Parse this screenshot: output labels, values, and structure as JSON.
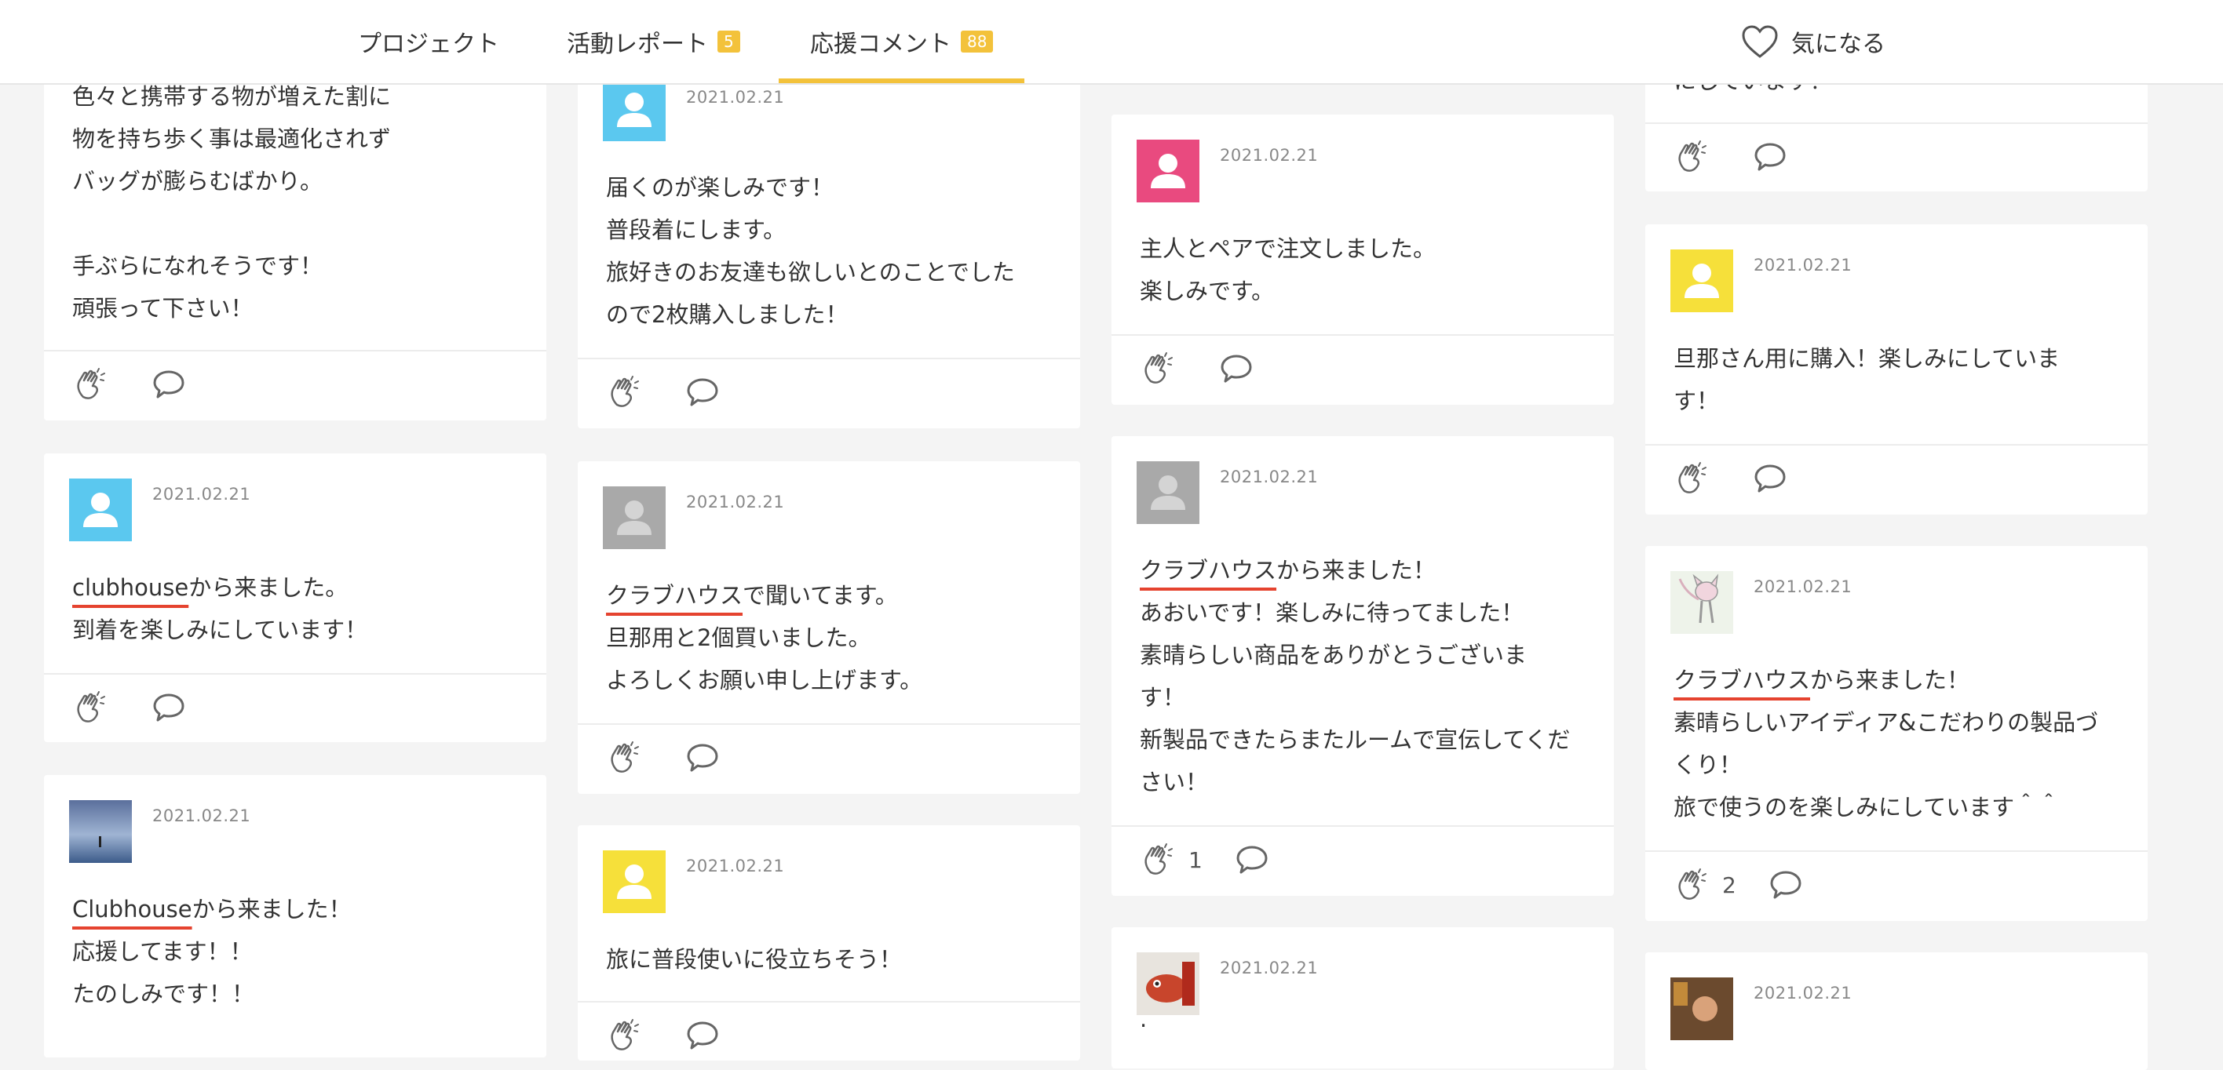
{
  "nav": {
    "tabs": [
      {
        "label": "プロジェクト"
      },
      {
        "label": "活動レポート",
        "badge": "5"
      },
      {
        "label": "応援コメント",
        "badge": "88"
      }
    ],
    "favorite_label": "気になる"
  },
  "cards": {
    "c1a": {
      "text_top": "色々と携帯する物が増えた割に\n物を持ち歩く事は最適化されず\nバッグが膨らむばかり。\n\n手ぶらになれそうです！\n頑張って下さい！"
    },
    "c1b": {
      "date": "2021.02.21",
      "hl": "clubhouse",
      "rest": "から来ました。\n到着を楽しみにしています！"
    },
    "c1c": {
      "date": "2021.02.21",
      "hl": "Clubhouse",
      "rest": "から来ました！\n応援してます！！\nたのしみです！！"
    },
    "c2a": {
      "date": "2021.02.21",
      "text": "届くのが楽しみです！\n普段着にします。\n旅好きのお友達も欲しいとのことでした\nので2枚購入しました！"
    },
    "c2b": {
      "date": "2021.02.21",
      "hl": "クラブハウス",
      "rest": "で聞いてます。\n旦那用と2個買いました。\nよろしくお願い申し上げます。"
    },
    "c2c": {
      "date": "2021.02.21",
      "text": "旅に普段使いに役立ちそう！"
    },
    "c3a": {
      "date": "2021.02.21",
      "text": "主人とペアで注文しました。\n楽しみです。"
    },
    "c3b": {
      "date": "2021.02.21",
      "hl": "クラブハウス",
      "rest": "から来ました！\nあおいです！楽しみに待ってました！\n素晴らしい商品をありがとうございま\nす！\n新製品できたらまたルームで宣伝してくだ\nさい！",
      "claps": "1"
    },
    "c3c": {
      "date": "2021.02.21",
      "text": "."
    },
    "c4a": {
      "text_top": "にしています！"
    },
    "c4b": {
      "date": "2021.02.21",
      "text": "旦那さん用に購入！楽しみにしていま\nす！"
    },
    "c4c": {
      "date": "2021.02.21",
      "hl": "クラブハウス",
      "rest": "から来ました！\n素晴らしいアイディア&こだわりの製品づ\nくり！\n旅で使うのを楽しみにしています＾＾",
      "claps": "2"
    },
    "c4d": {
      "date": "2021.02.21"
    }
  },
  "colors": {
    "accent": "#f3c23b",
    "underline": "#e5432f",
    "avatar_blue": "#5bc8ef",
    "avatar_pink": "#e94a7f",
    "avatar_gray": "#a9a9a9",
    "avatar_yellow": "#f6e03a"
  }
}
